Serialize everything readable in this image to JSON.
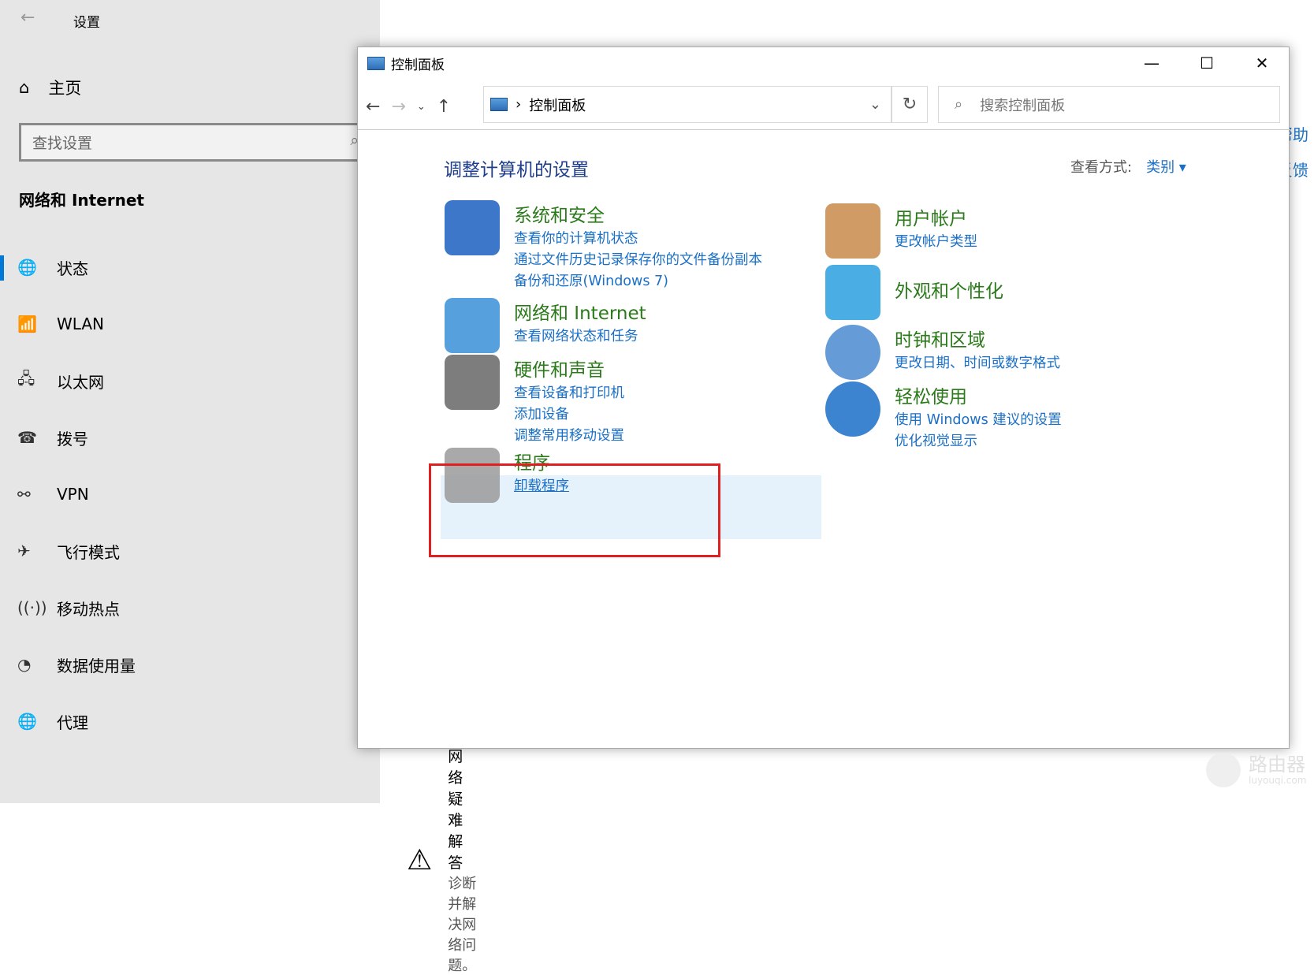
{
  "settings": {
    "title": "设置",
    "home": "主页",
    "search_placeholder": "查找设置",
    "section": "网络和 Internet",
    "nav": [
      {
        "label": "状态",
        "icon": "globe-status-icon"
      },
      {
        "label": "WLAN",
        "icon": "wifi-icon"
      },
      {
        "label": "以太网",
        "icon": "ethernet-icon"
      },
      {
        "label": "拨号",
        "icon": "dialup-icon"
      },
      {
        "label": "VPN",
        "icon": "vpn-icon"
      },
      {
        "label": "飞行模式",
        "icon": "airplane-icon"
      },
      {
        "label": "移动热点",
        "icon": "hotspot-icon"
      },
      {
        "label": "数据使用量",
        "icon": "data-usage-icon"
      },
      {
        "label": "代理",
        "icon": "globe-icon"
      }
    ],
    "right_links": [
      "帮助",
      "反馈"
    ],
    "troubleshoot": {
      "title": "网络疑难解答",
      "desc": "诊断并解决网络问题。"
    }
  },
  "window": {
    "title": "控制面板",
    "breadcrumb": "控制面板",
    "search_placeholder": "搜索控制面板",
    "heading": "调整计算机的设置",
    "view_by_label": "查看方式:",
    "view_by_value": "类别",
    "left_categories": [
      {
        "title": "系统和安全",
        "links": [
          "查看你的计算机状态",
          "通过文件历史记录保存你的文件备份副本",
          "备份和还原(Windows 7)"
        ]
      },
      {
        "title": "网络和 Internet",
        "links": [
          "查看网络状态和任务"
        ]
      },
      {
        "title": "硬件和声音",
        "links": [
          "查看设备和打印机",
          "添加设备",
          "调整常用移动设置"
        ]
      },
      {
        "title": "程序",
        "links": [
          "卸载程序"
        ]
      }
    ],
    "right_categories": [
      {
        "title": "用户帐户",
        "links": [
          "更改帐户类型"
        ]
      },
      {
        "title": "外观和个性化",
        "links": []
      },
      {
        "title": "时钟和区域",
        "links": [
          "更改日期、时间或数字格式"
        ]
      },
      {
        "title": "轻松使用",
        "links": [
          "使用 Windows 建议的设置",
          "优化视觉显示"
        ]
      }
    ]
  },
  "watermark": {
    "name": "路由器",
    "url": "luyouqi.com"
  }
}
